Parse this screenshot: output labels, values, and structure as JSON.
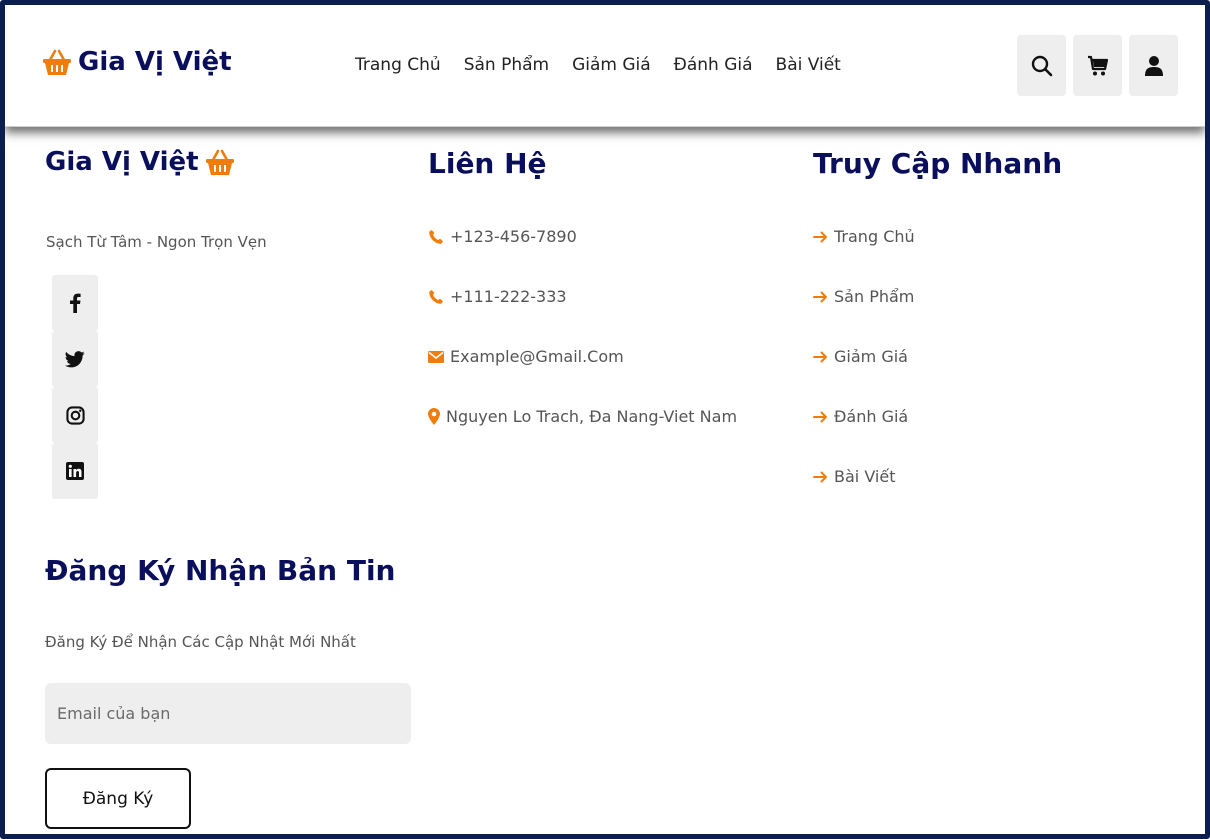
{
  "header": {
    "brand": "Gia Vị Việt",
    "nav": [
      "Trang Chủ",
      "Sản Phẩm",
      "Giảm Giá",
      "Đánh Giá",
      "Bài Viết"
    ]
  },
  "footer": {
    "brand_title": "Gia Vị Việt",
    "tagline": "Sạch Từ Tâm - Ngon Trọn Vẹn",
    "contact": {
      "title": "Liên Hệ",
      "items": [
        "+123-456-7890",
        "+111-222-333",
        "Example@Gmail.Com",
        "Nguyen Lo Trach, Đa Nang-Viet Nam"
      ]
    },
    "quick_links": {
      "title": "Truy Cập Nhanh",
      "items": [
        "Trang Chủ",
        "Sản Phẩm",
        "Giảm Giá",
        "Đánh Giá",
        "Bài Viết"
      ]
    },
    "newsletter": {
      "title": "Đăng Ký Nhận Bản Tin",
      "description": "Đăng Ký Để Nhận Các Cập Nhật Mới Nhất",
      "email_placeholder": "Email của bạn",
      "button_label": "Đăng Ký"
    }
  },
  "colors": {
    "accent": "#f07c0b",
    "heading": "#0a0f5c",
    "frame": "#0a1f4d"
  },
  "icons": {
    "brand": "basket-icon",
    "header_buttons": [
      "search-icon",
      "cart-icon",
      "user-icon"
    ],
    "social": [
      "facebook-icon",
      "twitter-icon",
      "instagram-icon",
      "linkedin-icon"
    ],
    "contact": [
      "phone-icon",
      "phone-icon",
      "envelope-icon",
      "map-pin-icon"
    ],
    "links": "arrow-right-icon"
  }
}
